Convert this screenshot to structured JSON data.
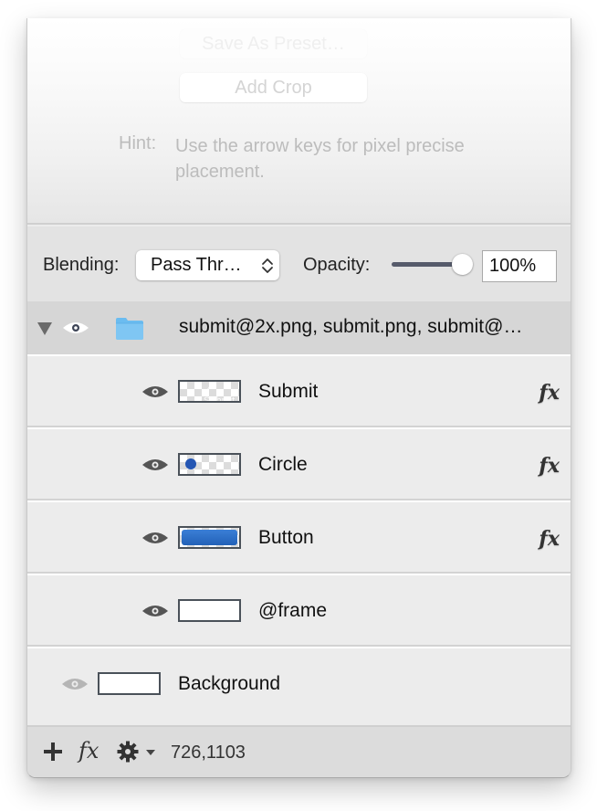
{
  "top": {
    "save_preset_label": "Save As Preset…",
    "add_crop_label": "Add Crop",
    "hint_label": "Hint:",
    "hint_text": "Use the arrow keys for pixel precise placement."
  },
  "blending": {
    "label": "Blending:",
    "selected": "Pass Thr…",
    "opacity_label": "Opacity:",
    "opacity_value": "100%",
    "opacity_slider_percent": 100
  },
  "group": {
    "name": "submit@2x.png, submit.png, submit@…",
    "expanded": true,
    "visible": true,
    "icon": "folder-icon",
    "folder_color": "#6bbcf0"
  },
  "layers": [
    {
      "name": "Submit",
      "visible": true,
      "thumbnail": "transparent-with-text",
      "has_fx": true,
      "fx_label": "fx"
    },
    {
      "name": "Circle",
      "visible": true,
      "thumbnail": "blue-dot",
      "has_fx": true,
      "fx_label": "fx"
    },
    {
      "name": "Button",
      "visible": true,
      "thumbnail": "blue-button",
      "has_fx": true,
      "fx_label": "fx"
    },
    {
      "name": "@frame",
      "visible": true,
      "thumbnail": "white",
      "has_fx": false
    }
  ],
  "background_layer": {
    "name": "Background",
    "visible": false,
    "thumbnail": "white"
  },
  "footer": {
    "add_icon": "plus-icon",
    "fx_label": "fx",
    "gear_icon": "gear-icon",
    "coordinates": "726,1103"
  },
  "colors": {
    "circle_blue": "#2456b3",
    "button_blue": "#2a6cc8",
    "eye_visible": "#555555",
    "eye_hidden": "#b5b5b5"
  }
}
